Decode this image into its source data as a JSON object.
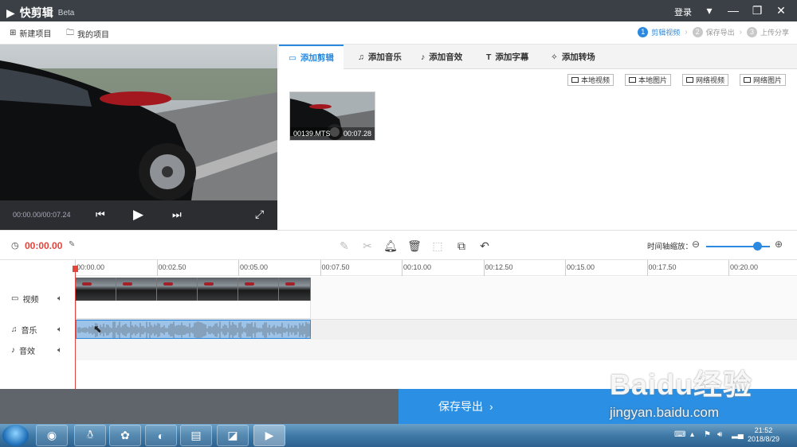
{
  "app": {
    "title": "快剪辑",
    "badge": "Beta"
  },
  "titlebar": {
    "login": "登录"
  },
  "menu": {
    "new_project": "新建项目",
    "my_projects": "我的项目"
  },
  "steps": [
    {
      "num": "1",
      "label": "剪辑视频",
      "active": true
    },
    {
      "num": "2",
      "label": "保存导出",
      "active": false
    },
    {
      "num": "3",
      "label": "上传分享",
      "active": false
    }
  ],
  "preview": {
    "timecode": "00:00.00/00:07.24"
  },
  "tabs": [
    {
      "label": "添加剪辑",
      "icon": "video-camera-icon",
      "active": true
    },
    {
      "label": "添加音乐",
      "icon": "music-note-icon"
    },
    {
      "label": "添加音效",
      "icon": "sound-effect-icon"
    },
    {
      "label": "添加字幕",
      "icon": "text-icon"
    },
    {
      "label": "添加转场",
      "icon": "transition-icon"
    }
  ],
  "source_buttons": [
    "本地视频",
    "本地图片",
    "网络视频",
    "网络图片"
  ],
  "clip": {
    "name": "00139.MTS",
    "duration": "00:07.28"
  },
  "toolbar": {
    "current_time": "00:00.00",
    "zoom_label": "时间轴缩放：",
    "zoom_level": 0.8
  },
  "ruler": [
    "00:00.00",
    "00:02.50",
    "00:05.00",
    "00:07.50",
    "00:10.00",
    "00:12.50",
    "00:15.00",
    "00:17.50",
    "00:20.00"
  ],
  "tracks": {
    "video": "视频",
    "music": "音乐",
    "sfx": "音效"
  },
  "export": {
    "label": "保存导出"
  },
  "watermark": {
    "line1": "Baidu经验",
    "line2": "jingyan.baidu.com"
  },
  "taskbar": {
    "time": "21:52",
    "date": "2018/8/29"
  },
  "colors": {
    "accent": "#2b8ae0",
    "timecode_red": "#e0463c",
    "titlebar": "#3a4046"
  }
}
